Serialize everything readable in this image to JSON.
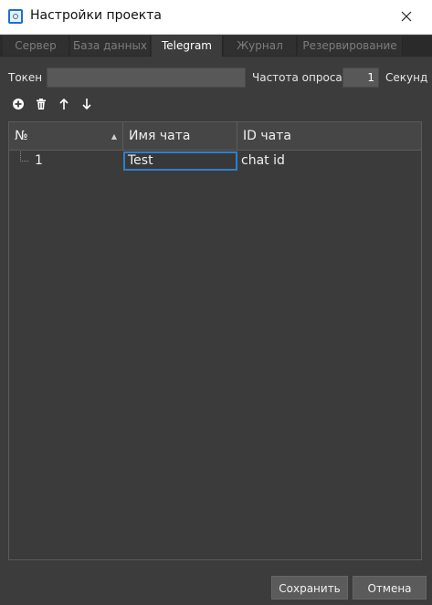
{
  "window": {
    "title": "Настройки проекта"
  },
  "tabs": [
    {
      "label": "Сервер",
      "active": false
    },
    {
      "label": "База данных",
      "active": false
    },
    {
      "label": "Telegram",
      "active": true
    },
    {
      "label": "Журнал",
      "active": false
    },
    {
      "label": "Резервирование",
      "active": false
    }
  ],
  "form": {
    "token_label": "Токен",
    "token_value": "",
    "poll_label": "Частота опроса",
    "poll_value": "1",
    "poll_unit": "Секунд"
  },
  "toolbar": {
    "icons": [
      "add-icon",
      "delete-icon",
      "move-up-icon",
      "move-down-icon"
    ]
  },
  "table": {
    "columns": [
      "№",
      "Имя чата",
      "ID чата"
    ],
    "sort_column": "№",
    "rows": [
      {
        "num": "1",
        "name": "Test",
        "id": "chat id"
      }
    ]
  },
  "buttons": {
    "save": "Сохранить",
    "cancel": "Отмена"
  },
  "colors": {
    "accent": "#2f7fc8",
    "background": "#3c3c3c",
    "titlebar": "#ffffff"
  }
}
